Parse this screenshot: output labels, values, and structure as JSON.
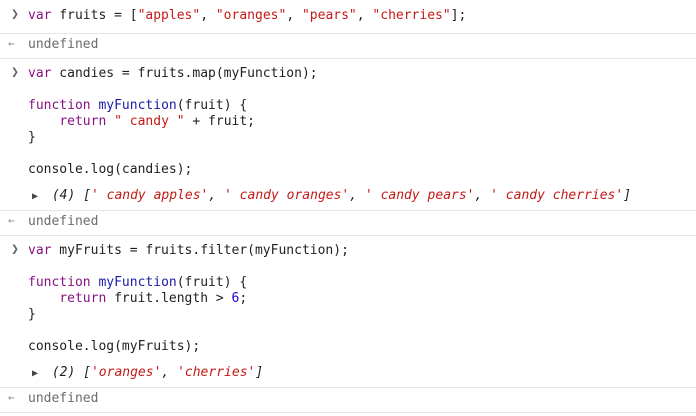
{
  "statement1": {
    "text_parts": [
      "var",
      " fruits = [",
      "\"apples\"",
      ", ",
      "\"oranges\"",
      ", ",
      "\"pears\"",
      ", ",
      "\"cherries\"",
      "];"
    ]
  },
  "result1": {
    "text": "undefined"
  },
  "statement2": {
    "line1": [
      "var",
      " candies = fruits.map(myFunction);"
    ],
    "line3": [
      "function",
      " ",
      "myFunction",
      "(fruit) {"
    ],
    "line4": [
      "    ",
      "return",
      " ",
      "\" candy \"",
      " + fruit;"
    ],
    "line5": "}",
    "line7": "console.log(candies);"
  },
  "log2": {
    "count": "(4)",
    "items": [
      "' candy apples'",
      "' candy oranges'",
      "' candy pears'",
      "' candy cherries'"
    ]
  },
  "result2": {
    "text": "undefined"
  },
  "statement3": {
    "line1": [
      "var",
      " myFruits = fruits.filter(myFunction);"
    ],
    "line3": [
      "function",
      " ",
      "myFunction",
      "(fruit) {"
    ],
    "line4": [
      "    ",
      "return",
      " fruit.length > ",
      "6",
      ";"
    ],
    "line5": "}",
    "line7": "console.log(myFruits);"
  },
  "log3": {
    "count": "(2)",
    "items": [
      "'oranges'",
      "'cherries'"
    ]
  },
  "result3": {
    "text": "undefined"
  },
  "icons": {
    "prompt": "chevron-right-icon",
    "result": "return-arrow-icon",
    "expand": "triangle-right-icon"
  },
  "colors": {
    "keyword": "#881280",
    "function_name": "#1a1aa6",
    "string": "#c41a16",
    "number": "#1c00cf",
    "muted": "#6b6b6b"
  }
}
